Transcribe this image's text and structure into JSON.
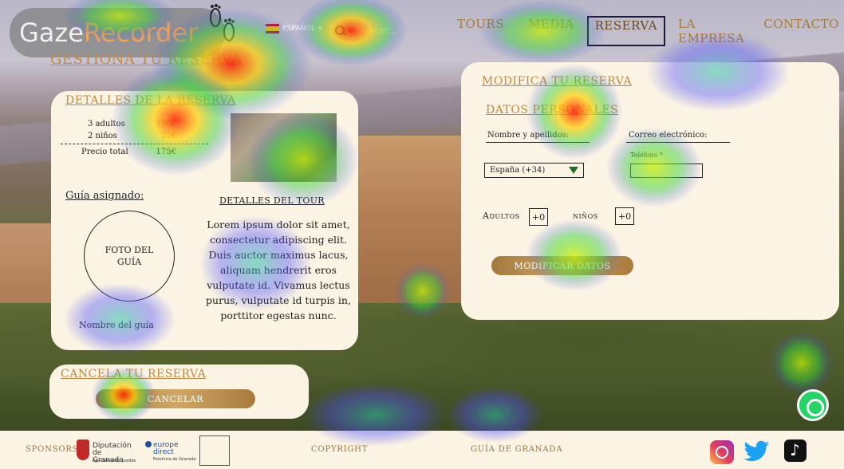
{
  "header": {
    "logo_text_a": "Gaze",
    "logo_text_b": "Recorder",
    "language": "ESPAÑOL",
    "search_placeholder": "Buscar...",
    "nav": [
      "TOURS",
      "MEDIA",
      "RESERVA",
      "LA EMPRESA",
      "CONTACTO"
    ],
    "active_nav": "RESERVA"
  },
  "page_title": "GESTIONA TU RESERVA",
  "details": {
    "title": "DETALLES DE LA RESERVA",
    "rows": [
      {
        "label": "3 adultos",
        "value": "150€"
      },
      {
        "label": "2 niños",
        "value": "25€"
      }
    ],
    "total_label": "Precio total",
    "total_value": "175€",
    "guide_title": "Guía asignado:",
    "guide_photo": "FOTO DEL GUÍA",
    "guide_name": "Nombre del guía",
    "tour_title": "DETALLES DEL TOUR",
    "tour_desc": "Lorem ipsum dolor sit amet, consectetur adipiscing elit. Duis auctor maximus lacus, aliquam hendrerit eros vulputate id. Vivamus lectus purus, vulputate id turpis in, porttitor egestas nunc."
  },
  "modify": {
    "title": "MODIFICA TU RESERVA",
    "subtitle": "DATOS PERSONALES",
    "name_label": "Nombre y apellidos:",
    "email_label": "Correo electrónico:",
    "phone_label": "Teléfono *",
    "country_code": "España (+34)",
    "adults_label": "Adultos",
    "adults_value": "+0",
    "kids_label": "niños",
    "kids_value": "+0",
    "button": "MODIFICAR DATOS"
  },
  "cancel": {
    "title": "CANCELA TU RESERVA",
    "button": "CANCELAR"
  },
  "footer": {
    "sponsors": "SPONSORS",
    "dip_name": "Diputación de Granada",
    "dip_sub": "Ayuntamiento posible",
    "eu_name": "europe direct",
    "eu_sub": "Provincia de Granada",
    "copyright": "COPYRIGHT",
    "guide": "GUÍA DE GRANADA"
  },
  "colors": {
    "accent_gold": "#c08a45",
    "card_bg": "#fbf4e4",
    "whatsapp": "#25d366"
  }
}
